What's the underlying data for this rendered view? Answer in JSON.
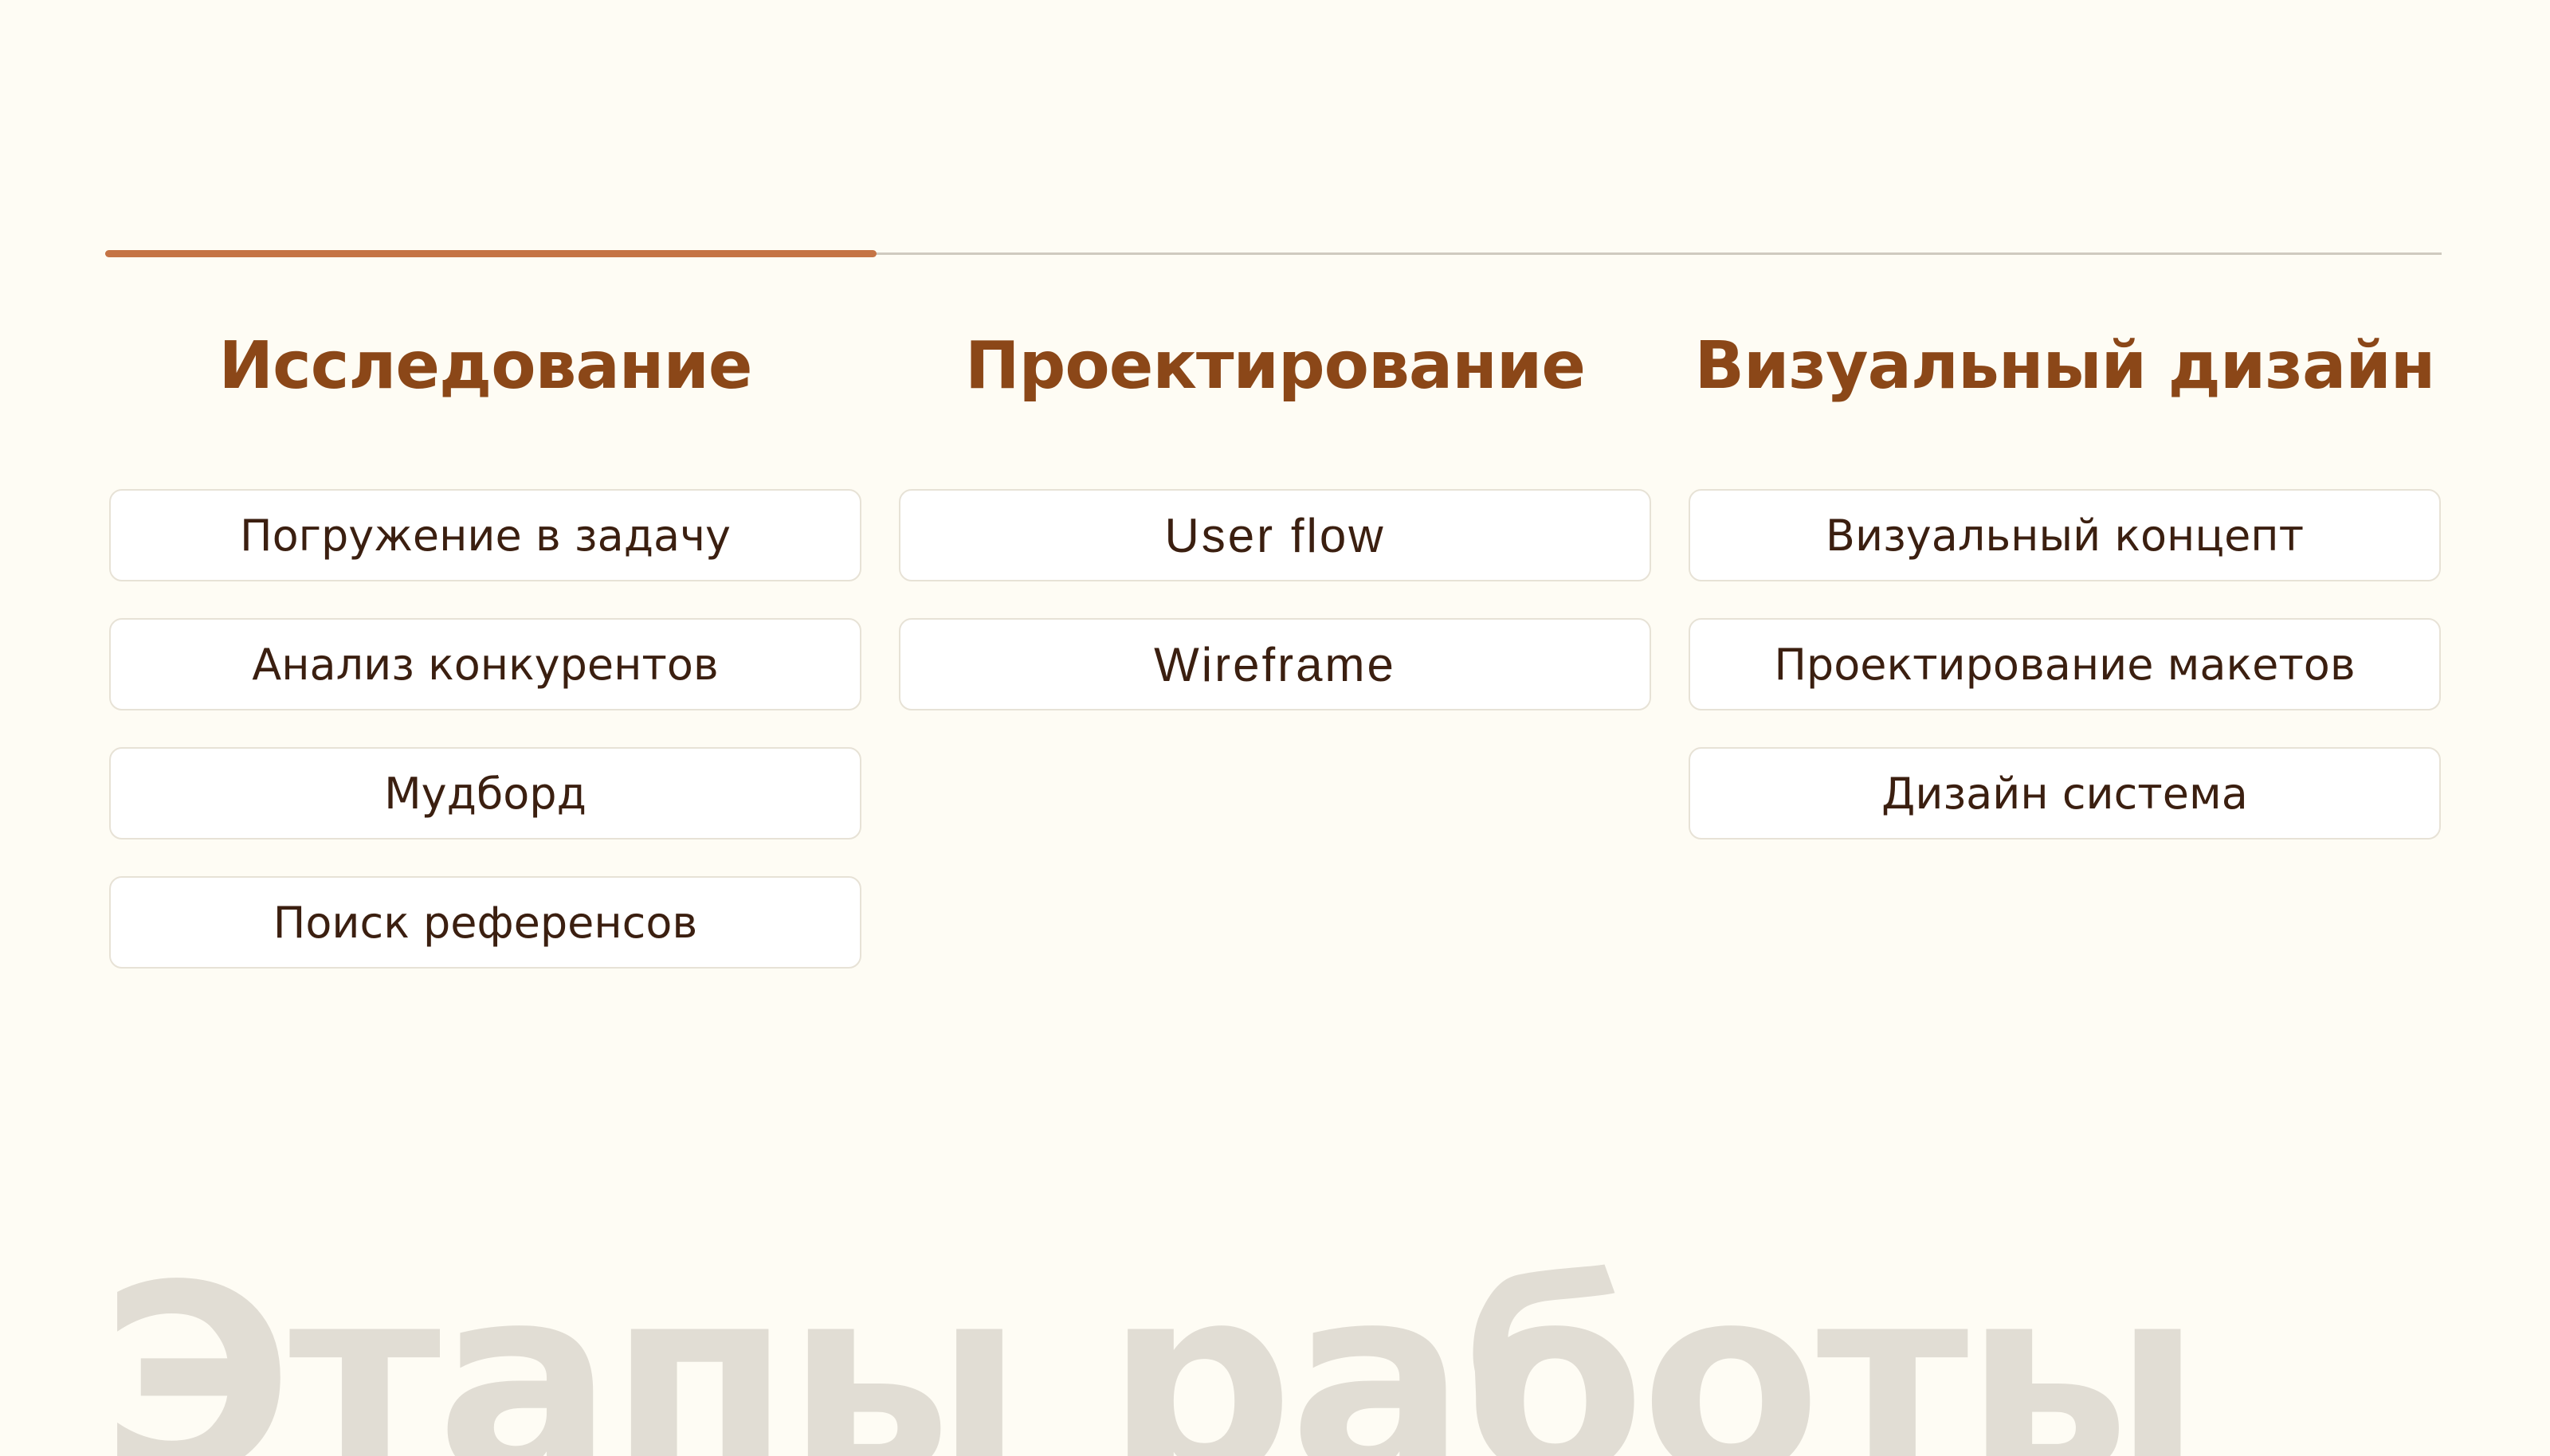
{
  "progress": {
    "value_percent": 33,
    "fill_color": "#c57445",
    "track_color": "#cfcabf"
  },
  "columns": [
    {
      "title": "Исследование",
      "items": [
        "Погружение в задачу",
        "Анализ конкурентов",
        "Мудборд",
        "Поиск референсов"
      ]
    },
    {
      "title": "Проектирование",
      "items": [
        "User flow",
        "Wireframe"
      ]
    },
    {
      "title": "Визуальный дизайн",
      "items": [
        "Визуальный концепт",
        "Проектирование макетов",
        "Дизайн система"
      ]
    }
  ],
  "watermark": "Этапы работы",
  "colors": {
    "background": "#fefcf4",
    "title": "#8b4718",
    "text": "#3b1f10",
    "watermark": "#e1ddd4"
  }
}
